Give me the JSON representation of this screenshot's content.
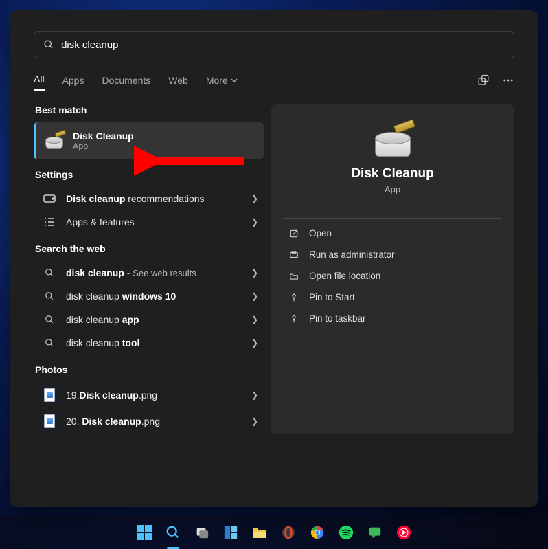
{
  "search": {
    "value": "disk cleanup"
  },
  "tabs": {
    "items": [
      "All",
      "Apps",
      "Documents",
      "Web",
      "More"
    ],
    "activeIndex": 0
  },
  "bestMatch": {
    "label": "Best match",
    "result": {
      "title": "Disk Cleanup",
      "subtitle": "App"
    }
  },
  "settings": {
    "label": "Settings",
    "items": [
      {
        "prefix": "Disk cleanup",
        "suffix": " recommendations",
        "icon": "storage-icon"
      },
      {
        "prefix": "",
        "suffix": "Apps & features",
        "icon": "list-icon"
      }
    ]
  },
  "web": {
    "label": "Search the web",
    "items": [
      {
        "t1": "disk cleanup",
        "t2": " - ",
        "t3": "See web results",
        "b1": true,
        "b2": false,
        "b3": false,
        "light3": true
      },
      {
        "t1": "disk cleanup ",
        "t2": "windows 10",
        "t3": "",
        "b1": false,
        "b2": true,
        "b3": false
      },
      {
        "t1": "disk cleanup ",
        "t2": "app",
        "t3": "",
        "b1": false,
        "b2": true,
        "b3": false
      },
      {
        "t1": "disk cleanup ",
        "t2": "tool",
        "t3": "",
        "b1": false,
        "b2": true,
        "b3": false
      }
    ]
  },
  "photos": {
    "label": "Photos",
    "items": [
      {
        "p1": "19.",
        "p2": "Disk cleanup",
        "p3": ".png"
      },
      {
        "p1": "20. ",
        "p2": "Disk cleanup",
        "p3": ".png"
      }
    ]
  },
  "detail": {
    "title": "Disk Cleanup",
    "subtitle": "App",
    "actions": [
      {
        "icon": "open-icon",
        "label": "Open"
      },
      {
        "icon": "shield-icon",
        "label": "Run as administrator"
      },
      {
        "icon": "folder-icon",
        "label": "Open file location"
      },
      {
        "icon": "pin-icon",
        "label": "Pin to Start"
      },
      {
        "icon": "pin-icon",
        "label": "Pin to taskbar"
      }
    ]
  },
  "taskbar": {
    "items": [
      "start-button",
      "search-button",
      "task-view-button",
      "widgets-button",
      "file-explorer-button",
      "opera-button",
      "chrome-button",
      "spotify-button",
      "chat-button",
      "youtube-music-button"
    ]
  }
}
